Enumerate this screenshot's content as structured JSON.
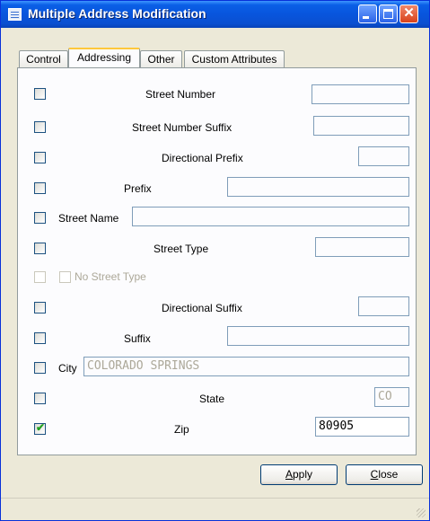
{
  "window": {
    "title": "Multiple Address Modification"
  },
  "tabs": [
    "Control",
    "Addressing",
    "Other",
    "Custom Attributes"
  ],
  "active_tab": "Addressing",
  "fields": {
    "street_number": {
      "label": "Street Number",
      "checked": false,
      "value": ""
    },
    "street_number_suffix": {
      "label": "Street Number Suffix",
      "checked": false,
      "value": ""
    },
    "directional_prefix": {
      "label": "Directional Prefix",
      "checked": false,
      "value": ""
    },
    "prefix": {
      "label": "Prefix",
      "checked": false,
      "value": ""
    },
    "street_name": {
      "label": "Street Name",
      "checked": false,
      "value": ""
    },
    "street_type": {
      "label": "Street Type",
      "checked": false,
      "value": ""
    },
    "no_street_type": {
      "label": "No Street Type",
      "checked": false,
      "enabled": false
    },
    "directional_suffix": {
      "label": "Directional Suffix",
      "checked": false,
      "value": ""
    },
    "suffix": {
      "label": "Suffix",
      "checked": false,
      "value": ""
    },
    "city": {
      "label": "City",
      "checked": false,
      "value": "COLORADO SPRINGS"
    },
    "state": {
      "label": "State",
      "checked": false,
      "value": "CO"
    },
    "zip": {
      "label": "Zip",
      "checked": true,
      "value": "80905"
    }
  },
  "buttons": {
    "apply": {
      "mnemonic": "A",
      "rest": "pply"
    },
    "close": {
      "mnemonic": "C",
      "rest": "lose"
    }
  },
  "icons": [
    "app-window-icon",
    "minimize-icon",
    "maximize-icon",
    "close-icon",
    "check-mark-icon",
    "resize-grip-icon"
  ],
  "colors": {
    "title_bar": "#0a5fe6",
    "dialog_bg": "#ece9d8",
    "tab_highlight": "#ffc83c",
    "checkmark": "#21a121"
  }
}
